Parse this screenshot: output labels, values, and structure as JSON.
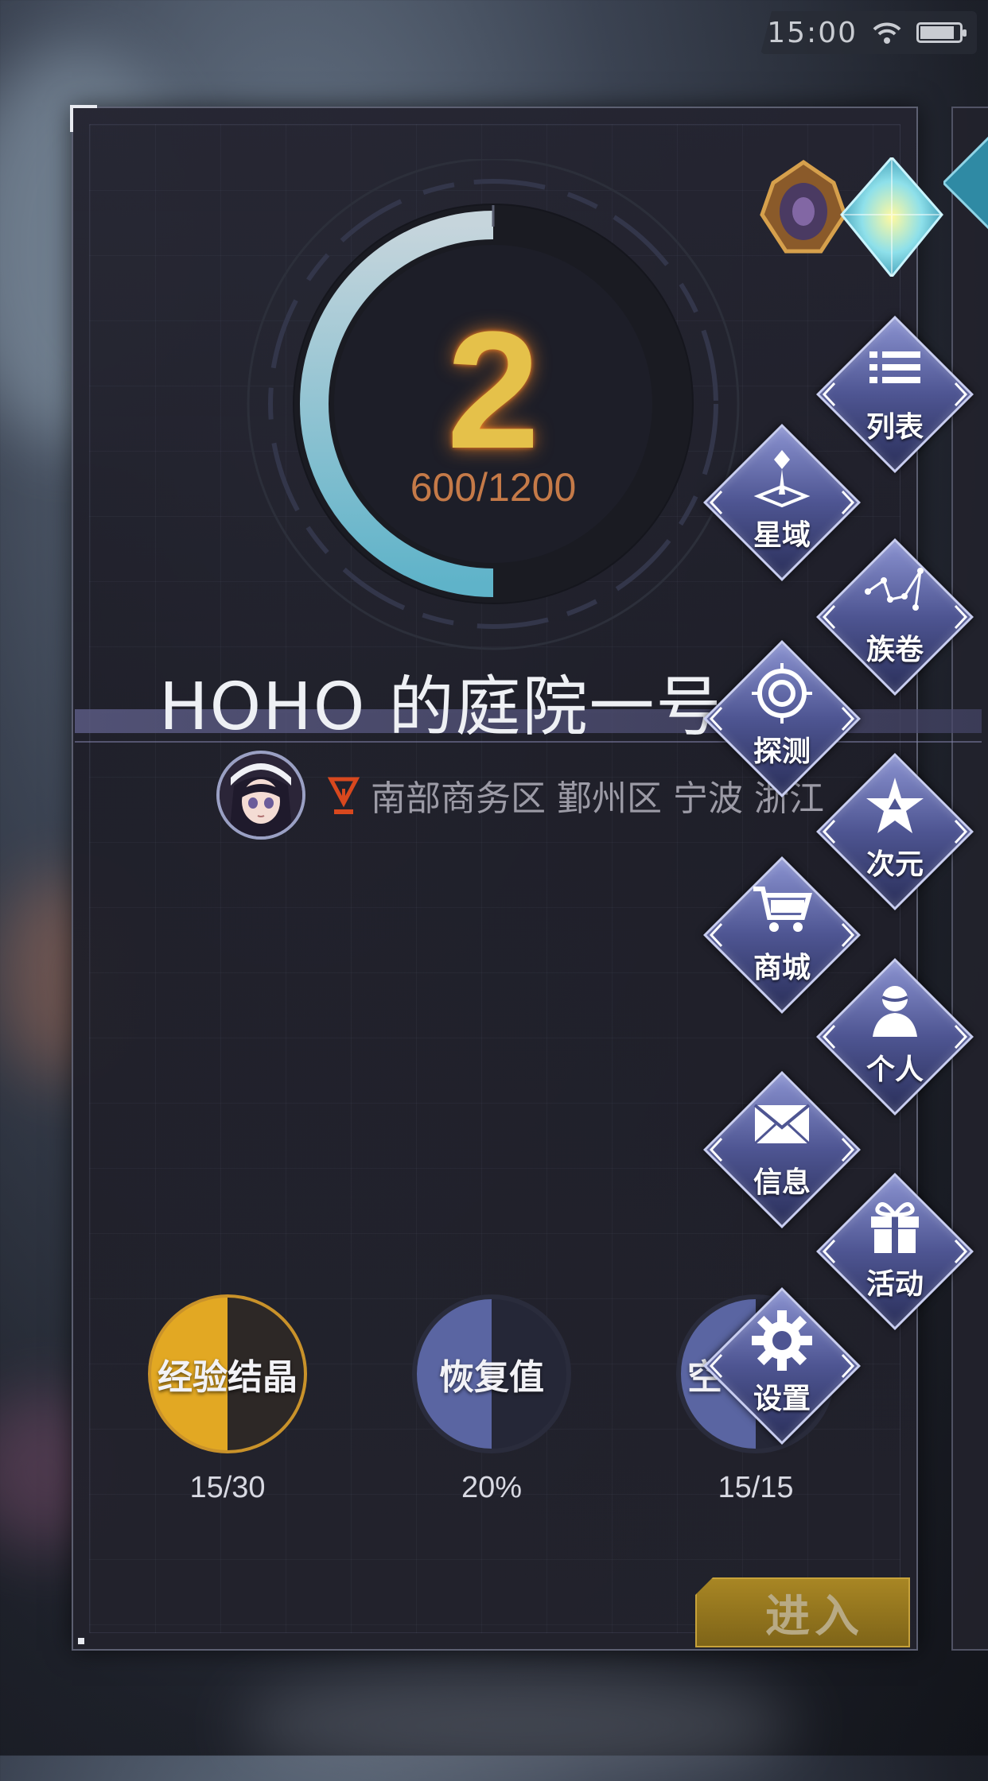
{
  "status_bar": {
    "time": "15:00"
  },
  "level": {
    "number": "2",
    "progress_text": "600/1200",
    "progress_fraction": 0.5
  },
  "garden": {
    "title": "HOHO 的庭院一号",
    "location": "南部商务区 鄞州区 宁波 浙江"
  },
  "stats": [
    {
      "label": "经验结晶",
      "value": "15/30"
    },
    {
      "label": "恢复值",
      "value": "20%"
    },
    {
      "label": "空",
      "value": "15/15"
    }
  ],
  "menu": {
    "list": "列表",
    "star_domain": "星域",
    "clan_scroll": "族卷",
    "detect": "探测",
    "dimension": "次元",
    "shop": "商城",
    "personal": "个人",
    "message": "信息",
    "event": "活动",
    "settings": "设置"
  },
  "enter_button": {
    "label": "进入"
  },
  "colors": {
    "accent_gold": "#e5c14a",
    "progress_orange": "#c57a48",
    "ring_cyan": "#5fb3c9",
    "menu_purple": "#4e5592"
  }
}
